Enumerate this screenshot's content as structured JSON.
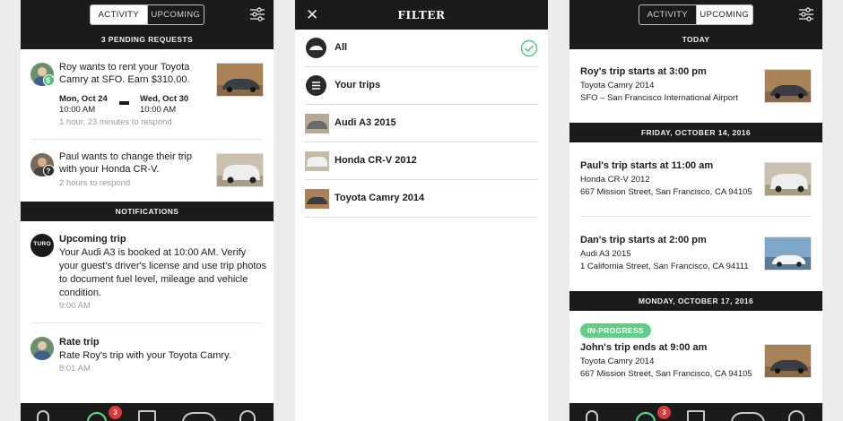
{
  "left": {
    "tabs": {
      "activity": "ACTIVITY",
      "upcoming": "UPCOMING"
    },
    "pending_header": "3 PENDING REQUESTS",
    "requests": [
      {
        "text": "Roy wants to rent your Toyota Camry at SFO. Earn $310.00.",
        "start_day": "Mon, Oct 24",
        "start_time": "10:00 AM",
        "end_day": "Wed, Oct 30",
        "end_time": "10:00 AM",
        "respond": "1 hour, 23 minutes to respond"
      },
      {
        "text": "Paul wants to change their trip with your Honda CR-V.",
        "respond": "2 hours to respond"
      }
    ],
    "notifications_header": "NOTIFICATIONS",
    "notifications": [
      {
        "avatar": "TURO",
        "title": "Upcoming trip",
        "text": "Your Audi A3 is booked at 10:00 AM. Verify your guest's driver's license and use trip photos to document fuel level, mileage and vehicle condition.",
        "time": "9:00 AM"
      },
      {
        "title": "Rate trip",
        "text": "Rate Roy's trip with your Toyota Camry.",
        "time": "8:01 AM"
      }
    ],
    "tabbar_badge": "3"
  },
  "filter": {
    "title": "FILTER",
    "items": [
      {
        "label": "All",
        "selected": true
      },
      {
        "label": "Your trips"
      },
      {
        "label": "Audi A3 2015"
      },
      {
        "label": "Honda CR-V 2012"
      },
      {
        "label": "Toyota Camry 2014"
      }
    ]
  },
  "right": {
    "tabs": {
      "activity": "ACTIVITY",
      "upcoming": "UPCOMING"
    },
    "sections": [
      {
        "header": "TODAY",
        "trips": [
          {
            "title": "Roy's trip starts at 3:00 pm",
            "car": "Toyota Camry 2014",
            "location": "SFO – San Francisco International Airport"
          }
        ]
      },
      {
        "header": "FRIDAY, OCTOBER 14, 2016",
        "trips": [
          {
            "title": "Paul's trip starts at 11:00 am",
            "car": "Honda CR-V 2012",
            "location": "667 Mission Street, San Francisco, CA 94105"
          },
          {
            "title": "Dan's trip starts at 2:00 pm",
            "car": "Audi A3 2015",
            "location": "1 California Street, San Francisco, CA 94111"
          }
        ]
      },
      {
        "header": "MONDAY, OCTOBER 17, 2016",
        "trips": [
          {
            "status": "IN-PROGRESS",
            "title": "John's trip ends at 9:00 am",
            "car": "Toyota Camry 2014",
            "location": "667 Mission Street, San Francisco, CA 94105"
          }
        ]
      }
    ],
    "tabbar_badge": "3"
  },
  "colors": {
    "dark": "#1b1b1b",
    "green": "#5ecf85",
    "badge_red": "#d9383a",
    "check_green": "#59c382"
  }
}
